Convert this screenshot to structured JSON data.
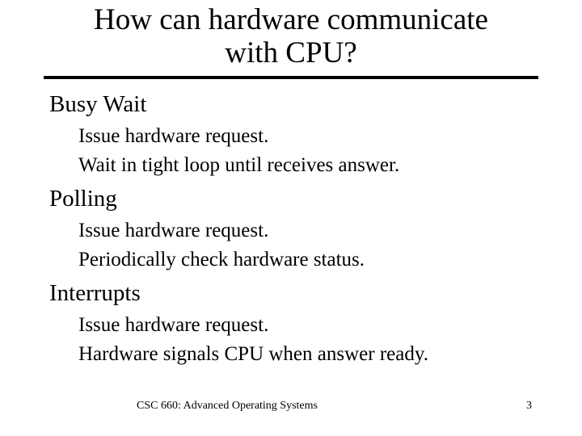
{
  "slide": {
    "title_line1": "How can hardware communicate",
    "title_line2": "with CPU?",
    "sections": [
      {
        "heading": "Busy Wait",
        "bullets": [
          "Issue hardware request.",
          "Wait in tight loop until receives answer."
        ]
      },
      {
        "heading": "Polling",
        "bullets": [
          "Issue hardware request.",
          "Periodically check hardware status."
        ]
      },
      {
        "heading": "Interrupts",
        "bullets": [
          "Issue hardware request.",
          "Hardware signals CPU when answer ready."
        ]
      }
    ],
    "footer": "CSC 660: Advanced Operating Systems",
    "page_number": "3"
  }
}
